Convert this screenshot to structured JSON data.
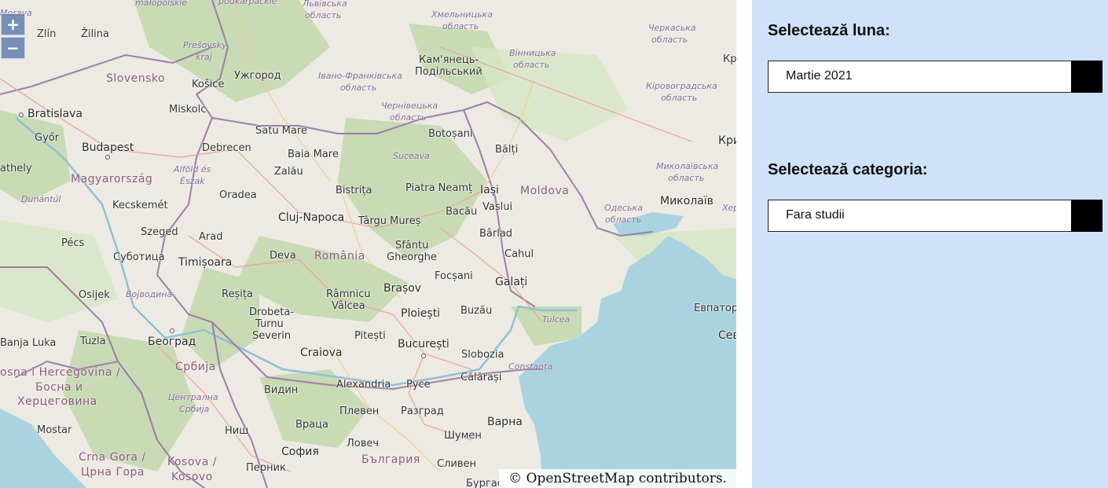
{
  "map": {
    "zoom_in": "+",
    "zoom_out": "−",
    "attribution": "© OpenStreetMap contributors.",
    "countries": {
      "romania": "România",
      "moldova": "Moldova",
      "slovensko": "Slovensko",
      "magyarorszag": "Magyarország",
      "srbija": "Србија",
      "bulgaria": "България",
      "bosnia_line1": "osna i Hercegovina /",
      "bosnia_line2": "Босна и",
      "bosnia_line3": "Херцеговина",
      "crna_gora": "Crna Gora /",
      "crna_gora_cyr": "Црна Гора",
      "kosova": "Kosova /",
      "kosovo": "Kosovo"
    },
    "cities": {
      "zlin": "Zlín",
      "zilina": "Žilina",
      "bratislava": "Bratislava",
      "gyor": "Győr",
      "budapest": "Budapest",
      "szekesfehervar": "athely",
      "kosice": "Košice",
      "miskolc": "Miskolc",
      "debrecen": "Debrecen",
      "uzhhorod": "Ужгород",
      "kamianets": "Кам'янець-",
      "podilskyi": "Подільський",
      "kirovohrad": "Кр",
      "satu_mare": "Satu Mare",
      "baia_mare": "Baia Mare",
      "zalau": "Zalău",
      "oradea": "Oradea",
      "botosani": "Botoșani",
      "balti": "Bălți",
      "suceava": "Suceava",
      "iasi": "Iași",
      "piatra_neamt": "Piatra Neamț",
      "vaslui": "Vaslui",
      "bacau": "Bacău",
      "barlad": "Bârlad",
      "bistrita": "Bistrița",
      "cluj": "Cluj-Napoca",
      "targu_mures": "Târgu Mureș",
      "kecskemet": "Kecskemét",
      "szeged": "Szeged",
      "arad": "Arad",
      "pecs": "Pécs",
      "subotica": "Суботица",
      "timisoara": "Timișoara",
      "deva": "Deva",
      "sfantu_gheorghe_1": "Sfântu",
      "sfantu_gheorghe_2": "Gheorghe",
      "cahul": "Cahul",
      "focsani": "Focșani",
      "galati": "Galați",
      "osijek": "Osijek",
      "resita": "Reșița",
      "ramnicu_1": "Râmnicu",
      "ramnicu_2": "Vâlcea",
      "brasov": "Brașov",
      "ploiesti": "Ploiești",
      "buzau": "Buzău",
      "tulcea": "Tulcea",
      "drobeta_1": "Drobeta-",
      "drobeta_2": "Turnu",
      "drobeta_3": "Severin",
      "pitesti": "Pitești",
      "bucuresti": "București",
      "slobozia": "Slobozia",
      "constanta": "Constanța",
      "banja_luka": "Banja Luka",
      "tuzla": "Tuzla",
      "beograd": "Београд",
      "craiova": "Craiova",
      "calarasi": "Călărași",
      "vidin": "Видин",
      "alexandria": "Alexandria",
      "ruse": "Русе",
      "pleven": "Плевен",
      "razgrad": "Разград",
      "varna": "Варна",
      "vratsa": "Враца",
      "shumen": "Шумен",
      "mostar": "Mostar",
      "nis": "Ниш",
      "lovech": "Ловеч",
      "sofia": "София",
      "pernik": "Перник",
      "sliven": "Сливен",
      "burgas": "Бургас",
      "mykolaiv": "Миколаїв",
      "odesa": "Одеська",
      "yevpatoria": "Евпатори",
      "sevastopol": "Сев",
      "kry": "Кри",
      "vojvodina": "Војводина"
    },
    "regions": {
      "malopolskie": "małopolskie",
      "podkarpackie": "podkarpackie",
      "lvivska_1": "Львівська",
      "lvivska_2": "область",
      "khmelnytska_1": "Хмельницька",
      "khmelnytska_2": "область",
      "cherkaska_1": "Черкаська",
      "cherkaska_2": "область",
      "morava": "Morava",
      "presovsky_1": "Prešovský",
      "presovsky_2": "kraj",
      "ivano_1": "Івано-Франківська",
      "ivano_2": "область",
      "vinnytska_1": "Вінницька",
      "vinnytska_2": "область",
      "kirovohradska_1": "Кіровоградська",
      "kirovohradska_2": "область",
      "chernivetska_1": "Чернівецька",
      "chernivetska_2": "область",
      "alfold_1": "Alföld és",
      "alfold_2": "Észak",
      "dunantul": "Dunántúl",
      "mykolaivska_1": "Миколаївська",
      "mykolaivska_2": "область",
      "odeska_1": "Одеська",
      "odeska_2": "область",
      "kher": "Хер",
      "tsentralna_1": "Централна",
      "tsentralna_2": "Србија"
    }
  },
  "panel": {
    "month_label": "Selectează luna:",
    "month_value": "Martie 2021",
    "category_label": "Selectează categoria:",
    "category_value": "Fara studii"
  },
  "colors": {
    "panel_bg": "#cfe2f9",
    "sea": "#aad3df",
    "land": "#eceae2",
    "forest": "#b9d4a3",
    "border": "#9e7ea7"
  }
}
